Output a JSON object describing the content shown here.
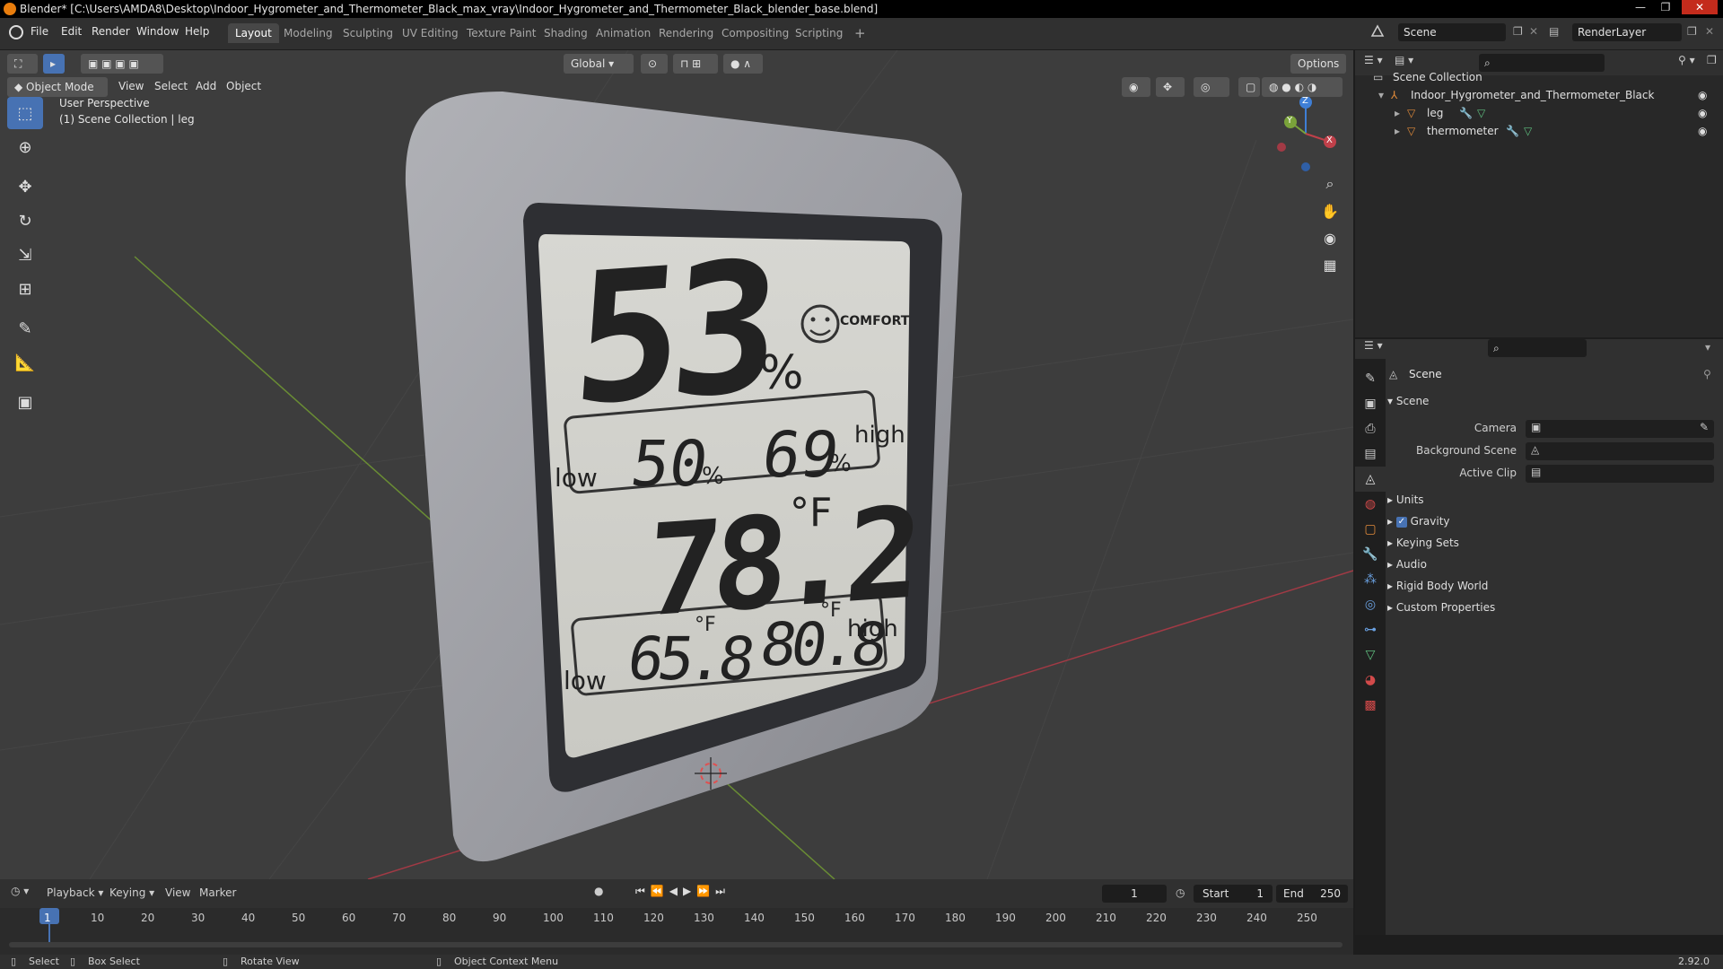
{
  "window": {
    "title": "Blender* [C:\\Users\\AMDA8\\Desktop\\Indoor_Hygrometer_and_Thermometer_Black_max_vray\\Indoor_Hygrometer_and_Thermometer_Black_blender_base.blend]",
    "minimize": "—",
    "maximize": "❐",
    "close": "✕"
  },
  "menu": [
    "File",
    "Edit",
    "Render",
    "Window",
    "Help"
  ],
  "workspaces": [
    "Layout",
    "Modeling",
    "Sculpting",
    "UV Editing",
    "Texture Paint",
    "Shading",
    "Animation",
    "Rendering",
    "Compositing",
    "Scripting"
  ],
  "workspace_add": "+",
  "scene_field": "Scene",
  "renderlayer_field": "RenderLayer",
  "viewport": {
    "orientation": "Global",
    "options": "Options",
    "mode": "Object Mode",
    "menus": [
      "View",
      "Select",
      "Add",
      "Object"
    ],
    "overlay_line1": "User Perspective",
    "overlay_line2": "(1) Scene Collection | leg",
    "gizmo_axes": [
      "Z",
      "Y",
      "X"
    ],
    "colors": {
      "bg": "#3d3d3d",
      "x_axis": "#c0404a",
      "y_axis": "#7aa33a",
      "z_axis": "#3f7fd6",
      "accent": "#4772b3"
    }
  },
  "device": {
    "humidity": "53",
    "humidity_unit": "%",
    "comfort": "COMFORT",
    "low_label": "low",
    "high_label": "high",
    "hum_low": "50",
    "hum_high": "69",
    "temp": "78.2",
    "temp_unit": "°F",
    "temp_low": "65.8",
    "temp_high": "80.8"
  },
  "outliner": {
    "root": "Scene Collection",
    "items": [
      {
        "label": "Indoor_Hygrometer_and_Thermometer_Black"
      },
      {
        "label": "leg"
      },
      {
        "label": "thermometer"
      }
    ]
  },
  "properties": {
    "header": "Scene",
    "section": "Scene",
    "fields": [
      {
        "label": "Camera"
      },
      {
        "label": "Background Scene"
      },
      {
        "label": "Active Clip"
      }
    ],
    "panels": [
      "Units",
      "Gravity",
      "Keying Sets",
      "Audio",
      "Rigid Body World",
      "Custom Properties"
    ]
  },
  "timeline": {
    "menus": [
      "Playback",
      "Keying",
      "View",
      "Marker"
    ],
    "current_frame": "1",
    "start_label": "Start",
    "start": "1",
    "end_label": "End",
    "end": "250",
    "ticks": [
      "1",
      "10",
      "20",
      "30",
      "40",
      "50",
      "60",
      "70",
      "80",
      "90",
      "100",
      "110",
      "120",
      "130",
      "140",
      "150",
      "160",
      "170",
      "180",
      "190",
      "200",
      "210",
      "220",
      "230",
      "240",
      "250"
    ]
  },
  "status": {
    "select": "Select",
    "box_select": "Box Select",
    "rotate": "Rotate View",
    "context": "Object Context Menu",
    "version": "2.92.0"
  }
}
